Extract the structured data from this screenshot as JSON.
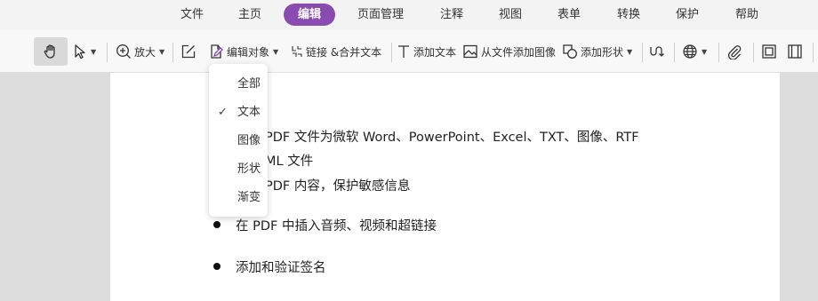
{
  "menu": {
    "items": [
      "文件",
      "主页",
      "编辑",
      "页面管理",
      "注释",
      "视图",
      "表单",
      "转换",
      "保护",
      "帮助"
    ],
    "active": "编辑"
  },
  "toolbar": {
    "zoom_in": "放大",
    "edit_object": "编辑对象",
    "link_merge": "链接 &合并文本",
    "add_text": "添加文本",
    "add_image": "从文件添加图像",
    "add_shape": "添加形状"
  },
  "dropdown": {
    "items": [
      "全部",
      "文本",
      "图像",
      "形状",
      "渐变"
    ],
    "checked": "文本"
  },
  "document": {
    "line1": "PDF 文件为微软 Word、PowerPoint、Excel、TXT、图像、RTF",
    "line2": "ML 文件",
    "line3": "PDF 内容，保护敏感信息",
    "bullet1": "在 PDF 中插入音频、视频和超链接",
    "bullet2": "添加和验证签名"
  },
  "colors": {
    "accent": "#8a4bb0"
  }
}
